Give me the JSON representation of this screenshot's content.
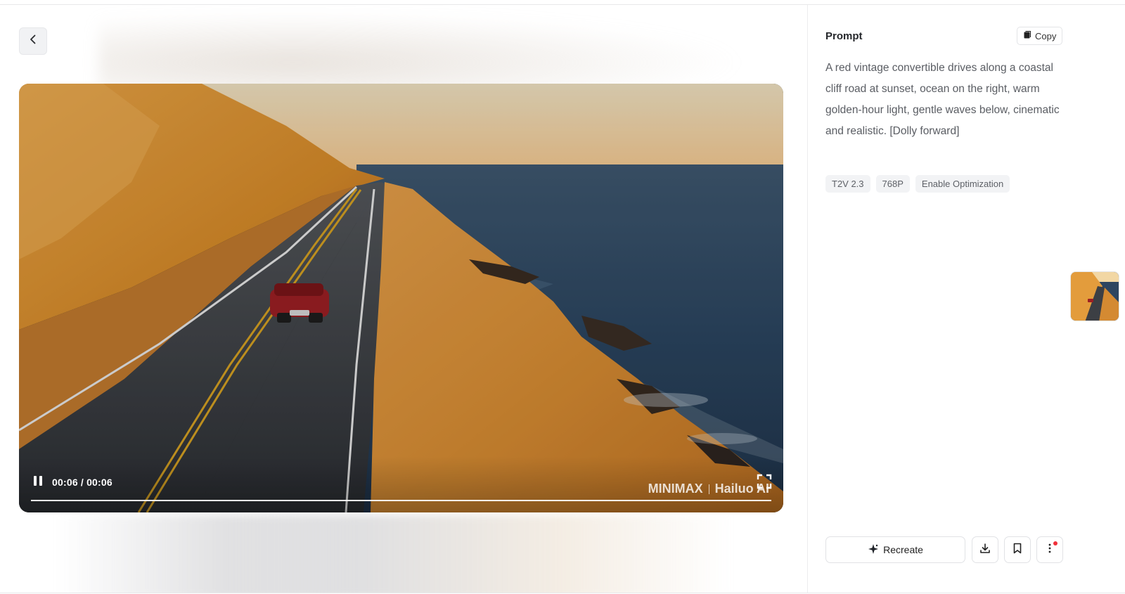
{
  "navigation": {
    "back_icon": "chevron-left-icon"
  },
  "player": {
    "time_display": "00:06 / 00:06",
    "progress": 1.0,
    "state": "playing",
    "pause_icon": "pause-icon",
    "fullscreen_icon": "fullscreen-icon",
    "watermark": {
      "brand_left": "MINIMAX",
      "separator": "|",
      "brand_right": "Hailuo AI"
    }
  },
  "prompt_panel": {
    "title": "Prompt",
    "copy_label": "Copy",
    "copy_icon": "copy-icon",
    "text": "A red vintage convertible drives along a coastal cliff road at sunset, ocean on the right, warm golden-hour light, gentle waves below, cinematic and realistic. [Dolly forward]",
    "tags": [
      "T2V 2.3",
      "768P",
      "Enable Optimization"
    ]
  },
  "actions": {
    "recreate_label": "Recreate",
    "recreate_icon": "sparkle-icon",
    "download_icon": "download-icon",
    "bookmark_icon": "bookmark-icon",
    "more_icon": "more-vertical-icon",
    "notification_color": "#f0303a"
  },
  "colors": {
    "cliff": "#e0962e",
    "ocean": "#243a52",
    "sky": "#f3d9a8",
    "road": "#3a3d42"
  }
}
